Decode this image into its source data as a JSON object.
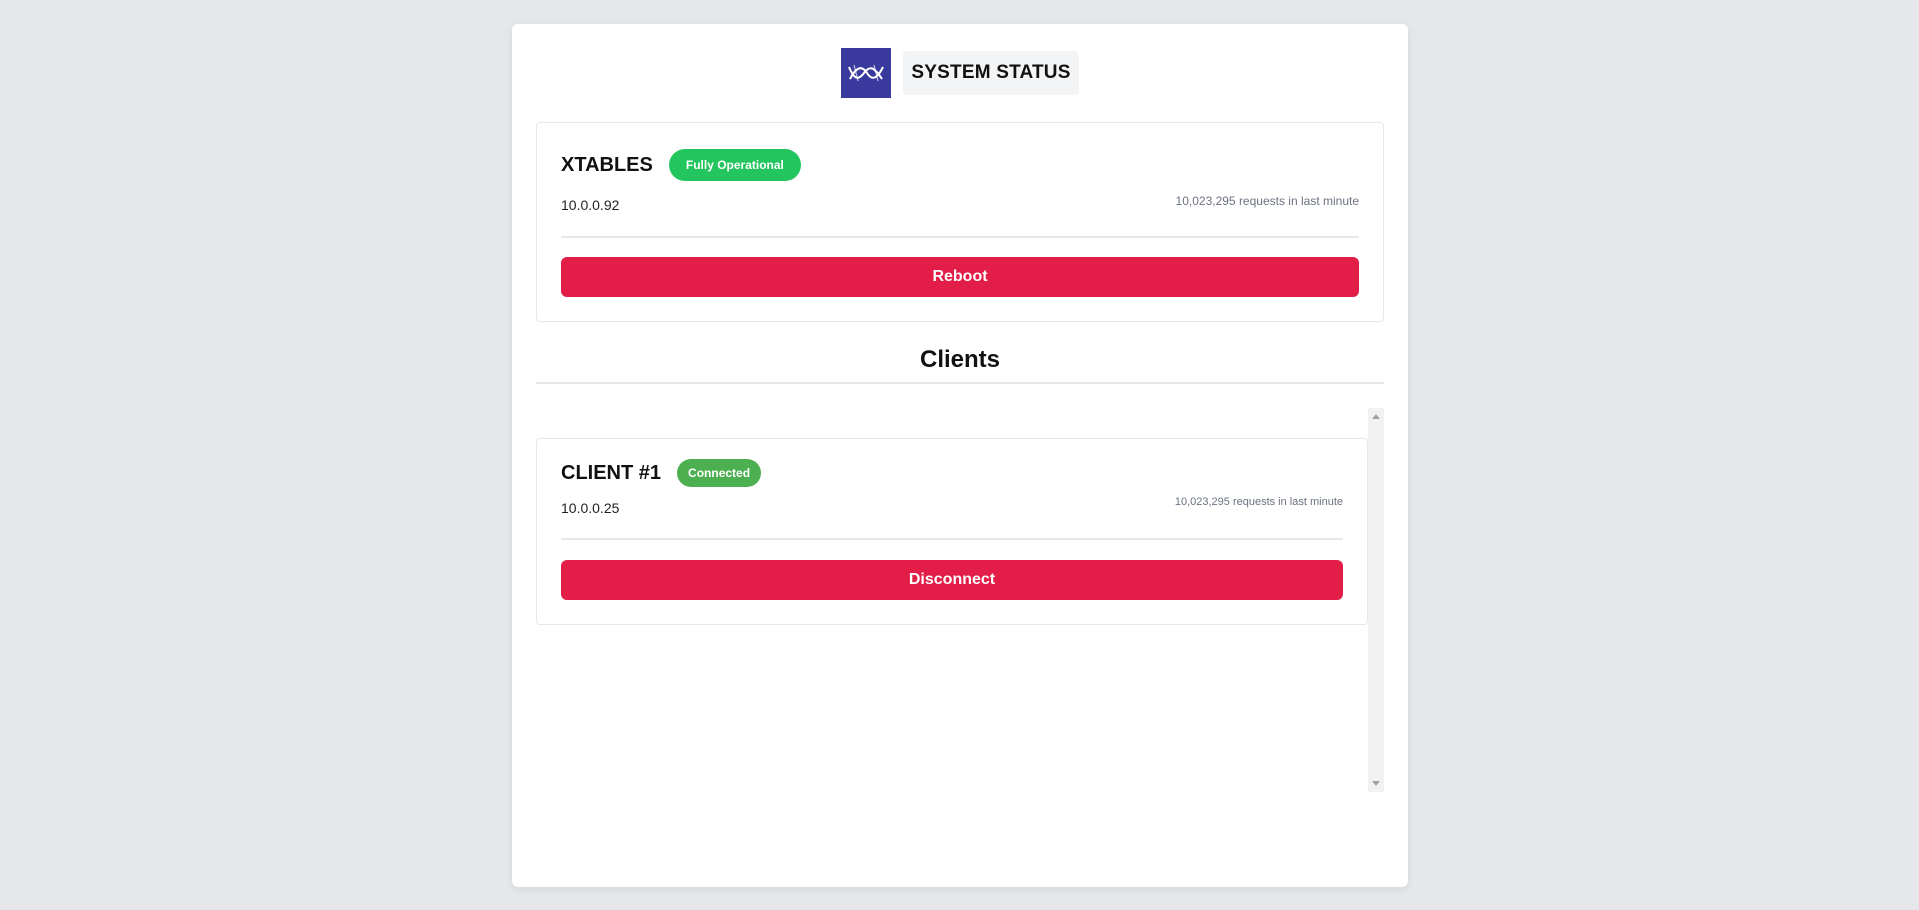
{
  "header": {
    "title": "SYSTEM STATUS",
    "logo_icon": "wave-logo-icon"
  },
  "server": {
    "name": "XTABLES",
    "status": "Fully Operational",
    "status_color": "#22c55e",
    "ip": "10.0.0.92",
    "requests": "10,023,295 requests in last minute",
    "action_label": "Reboot",
    "action_color": "#e11d48"
  },
  "clients": {
    "heading": "Clients",
    "items": [
      {
        "name": "CLIENT #1",
        "status": "Connected",
        "status_color": "#4caf50",
        "ip": "10.0.0.25",
        "requests": "10,023,295 requests in last minute",
        "action_label": "Disconnect",
        "action_color": "#e11d48"
      }
    ]
  }
}
